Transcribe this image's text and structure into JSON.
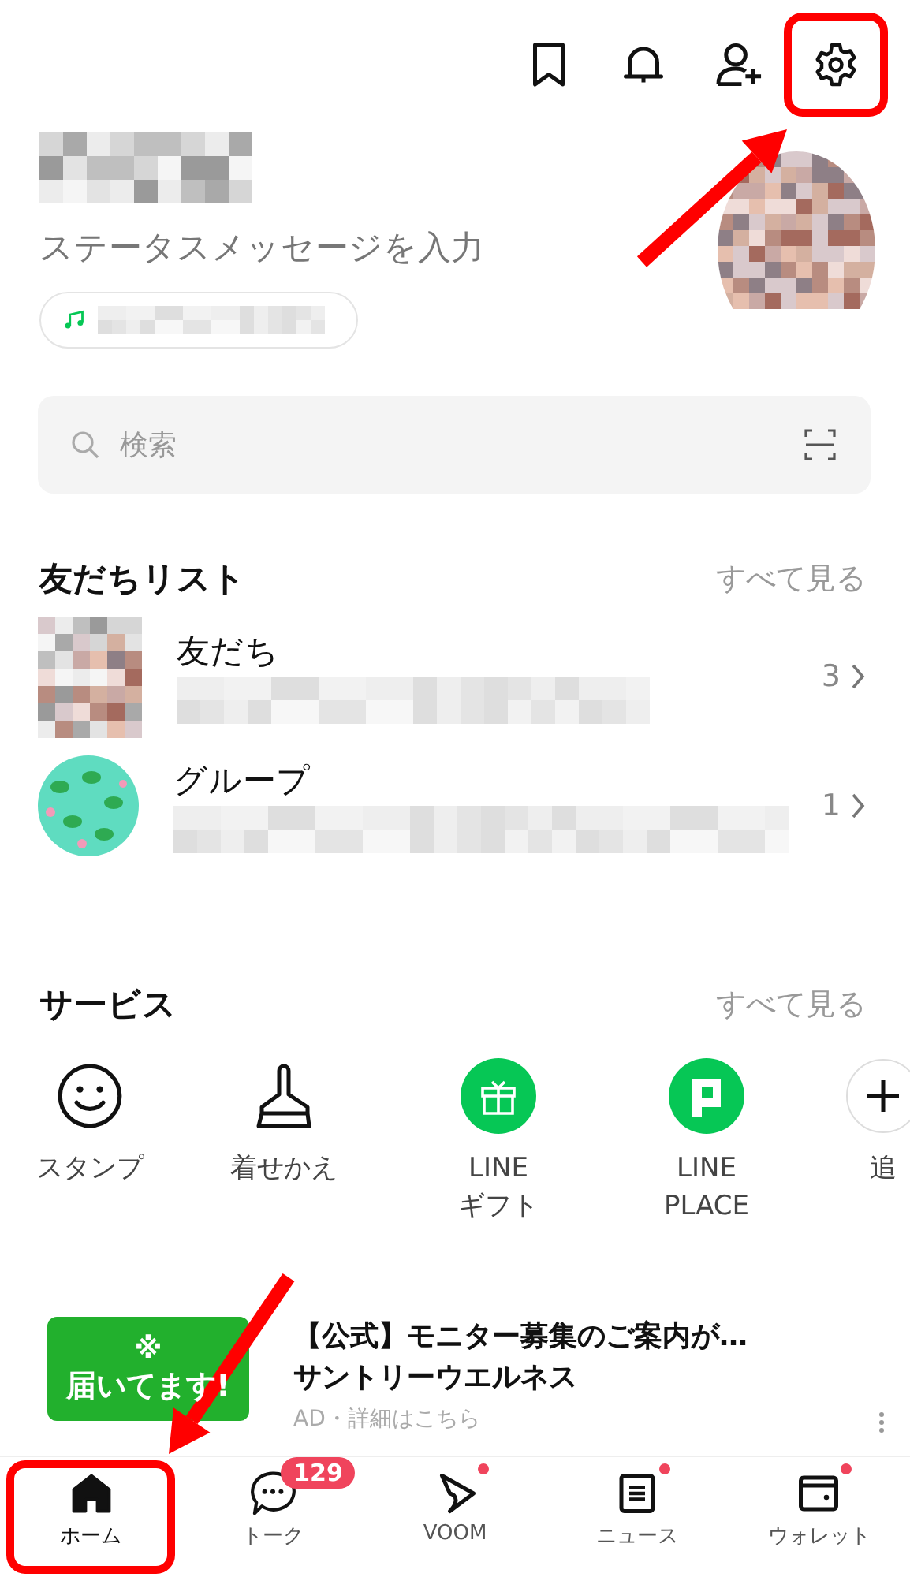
{
  "top_bar": {
    "icons": [
      {
        "kind": "bookmark",
        "highlighted": false
      },
      {
        "kind": "bell",
        "highlighted": false
      },
      {
        "kind": "add-friend",
        "highlighted": false
      },
      {
        "kind": "settings",
        "highlighted": true
      }
    ]
  },
  "profile": {
    "status_message": "ステータスメッセージを入力"
  },
  "search": {
    "placeholder": "検索"
  },
  "friends": {
    "title": "友だちリスト",
    "see_all": "すべて見る",
    "rows": [
      {
        "kind": "friends",
        "name": "友だち",
        "count": "3"
      },
      {
        "kind": "groups",
        "name": "グループ",
        "count": "1"
      }
    ]
  },
  "services": {
    "title": "サービス",
    "see_all": "すべて見る",
    "items": [
      {
        "kind": "smiley",
        "label_lines": [
          "スタンプ"
        ]
      },
      {
        "kind": "brush",
        "label_lines": [
          "着せかえ"
        ]
      },
      {
        "kind": "gift",
        "label_lines": [
          "LINE",
          "ギフト"
        ]
      },
      {
        "kind": "place",
        "label_lines": [
          "LINE",
          "PLACE"
        ]
      },
      {
        "kind": "plus",
        "label_lines": [
          "追"
        ]
      }
    ]
  },
  "ad": {
    "banner_symbol": "※",
    "banner_text": "届いてます!",
    "title": "【公式】モニター募集のご案内が…",
    "advertiser": "サントリーウエルネス",
    "meta": "AD・詳細はこちら"
  },
  "nav": {
    "tabs": [
      {
        "kind": "home",
        "label": "ホーム",
        "selected": true,
        "highlighted": true,
        "dot": false
      },
      {
        "kind": "talk",
        "label": "トーク",
        "selected": false,
        "highlighted": false,
        "dot": false,
        "badge": "129"
      },
      {
        "kind": "voom",
        "label": "VOOM",
        "selected": false,
        "highlighted": false,
        "dot": true
      },
      {
        "kind": "news",
        "label": "ニュース",
        "selected": false,
        "highlighted": false,
        "dot": true
      },
      {
        "kind": "wallet",
        "label": "ウォレット",
        "selected": false,
        "highlighted": false,
        "dot": true
      }
    ]
  }
}
